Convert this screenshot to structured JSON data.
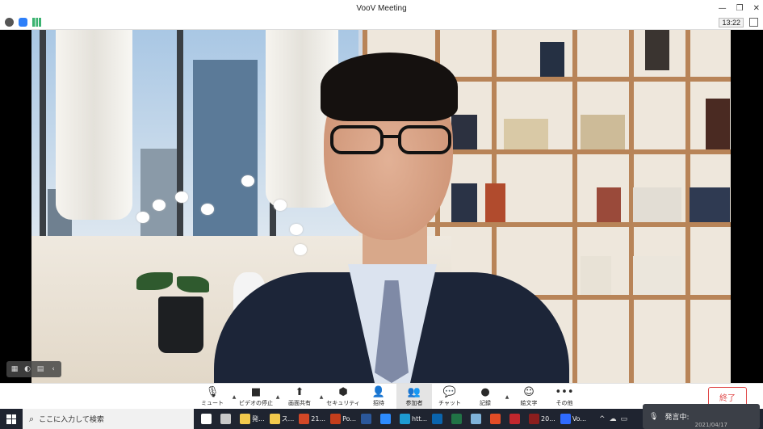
{
  "window": {
    "title": "VooV Meeting",
    "controls": [
      "—",
      "❐",
      "✕"
    ],
    "clock": "13:22"
  },
  "status_icons": [
    "info-icon",
    "shield-icon",
    "signal-icon"
  ],
  "toolbar": {
    "items": [
      {
        "id": "mute",
        "label": "ミュート",
        "icon": "microphone-icon",
        "glyph": "🎙",
        "caret": true
      },
      {
        "id": "video",
        "label": "ビデオの停止",
        "icon": "camera-icon",
        "glyph": "■",
        "caret": true
      },
      {
        "id": "share",
        "label": "画面共有",
        "icon": "share-screen-icon",
        "glyph": "⬆",
        "caret": true
      },
      {
        "id": "security",
        "label": "セキュリティ",
        "icon": "security-icon",
        "glyph": "⬢",
        "caret": false
      },
      {
        "id": "invite",
        "label": "招待",
        "icon": "invite-icon",
        "glyph": "👤",
        "caret": false
      },
      {
        "id": "participants",
        "label": "参加者",
        "icon": "participants-icon",
        "glyph": "👥",
        "caret": false,
        "active": true
      },
      {
        "id": "chat",
        "label": "チャット",
        "icon": "chat-icon",
        "glyph": "💬",
        "caret": false
      },
      {
        "id": "record",
        "label": "記録",
        "icon": "record-icon",
        "glyph": "●",
        "caret": true
      },
      {
        "id": "emoji",
        "label": "絵文字",
        "icon": "emoji-icon",
        "glyph": "☺",
        "caret": false
      },
      {
        "id": "more",
        "label": "その他",
        "icon": "more-icon",
        "glyph": "•••",
        "caret": false
      }
    ],
    "end_label": "終了"
  },
  "taskbar": {
    "search_placeholder": "ここに入力して検索",
    "apps": [
      {
        "label": "",
        "color": "#ffffff",
        "icon": "task-view-icon"
      },
      {
        "label": "",
        "color": "#c9c9c9",
        "icon": "task-icon"
      },
      {
        "label": "発...",
        "color": "#f2c94c",
        "icon": "folder-icon"
      },
      {
        "label": "ス...",
        "color": "#f2c94c",
        "icon": "folder-icon"
      },
      {
        "label": "21...",
        "color": "#d24726",
        "icon": "powerpoint-icon"
      },
      {
        "label": "Po...",
        "color": "#c43e1c",
        "icon": "powerpoint-icon"
      },
      {
        "label": "",
        "color": "#2b579a",
        "icon": "word-icon"
      },
      {
        "label": "",
        "color": "#2d8cff",
        "icon": "zoom-icon"
      },
      {
        "label": "htt...",
        "color": "#1d9bd1",
        "icon": "edge-icon"
      },
      {
        "label": "",
        "color": "#0a64ad",
        "icon": "outlook-icon"
      },
      {
        "label": "",
        "color": "#217346",
        "icon": "excel-icon"
      },
      {
        "label": "",
        "color": "#7fb2d9",
        "icon": "app-icon"
      },
      {
        "label": "",
        "color": "#e34c26",
        "icon": "app-icon"
      },
      {
        "label": "",
        "color": "#c1272d",
        "icon": "app-icon"
      },
      {
        "label": "20...",
        "color": "#8b1e1e",
        "icon": "app-icon"
      },
      {
        "label": "Vo...",
        "color": "#2f6bff",
        "icon": "voov-icon"
      }
    ]
  },
  "toast": {
    "text": "発言中:",
    "date": "2021/04/17"
  }
}
